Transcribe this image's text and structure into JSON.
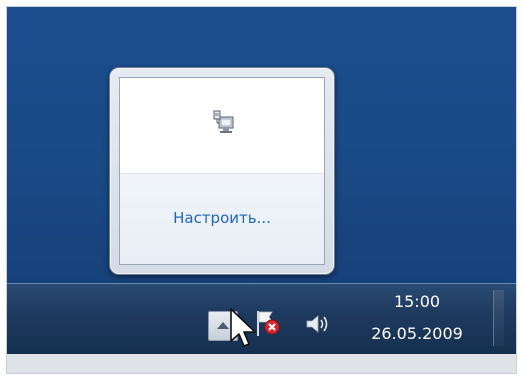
{
  "popup": {
    "customize_label": "Настроить..."
  },
  "taskbar": {
    "clock": {
      "time": "15:00",
      "date": "26.05.2009"
    }
  },
  "icons": {
    "network": "network-icon",
    "show_hidden": "chevron-up-icon",
    "action_center": "flag-error-icon",
    "volume": "speaker-icon",
    "pointer": "mouse-cursor-icon"
  },
  "colors": {
    "desktop": "#1a4a86",
    "taskbar": "#1f3a5f",
    "link": "#1f66b8"
  }
}
